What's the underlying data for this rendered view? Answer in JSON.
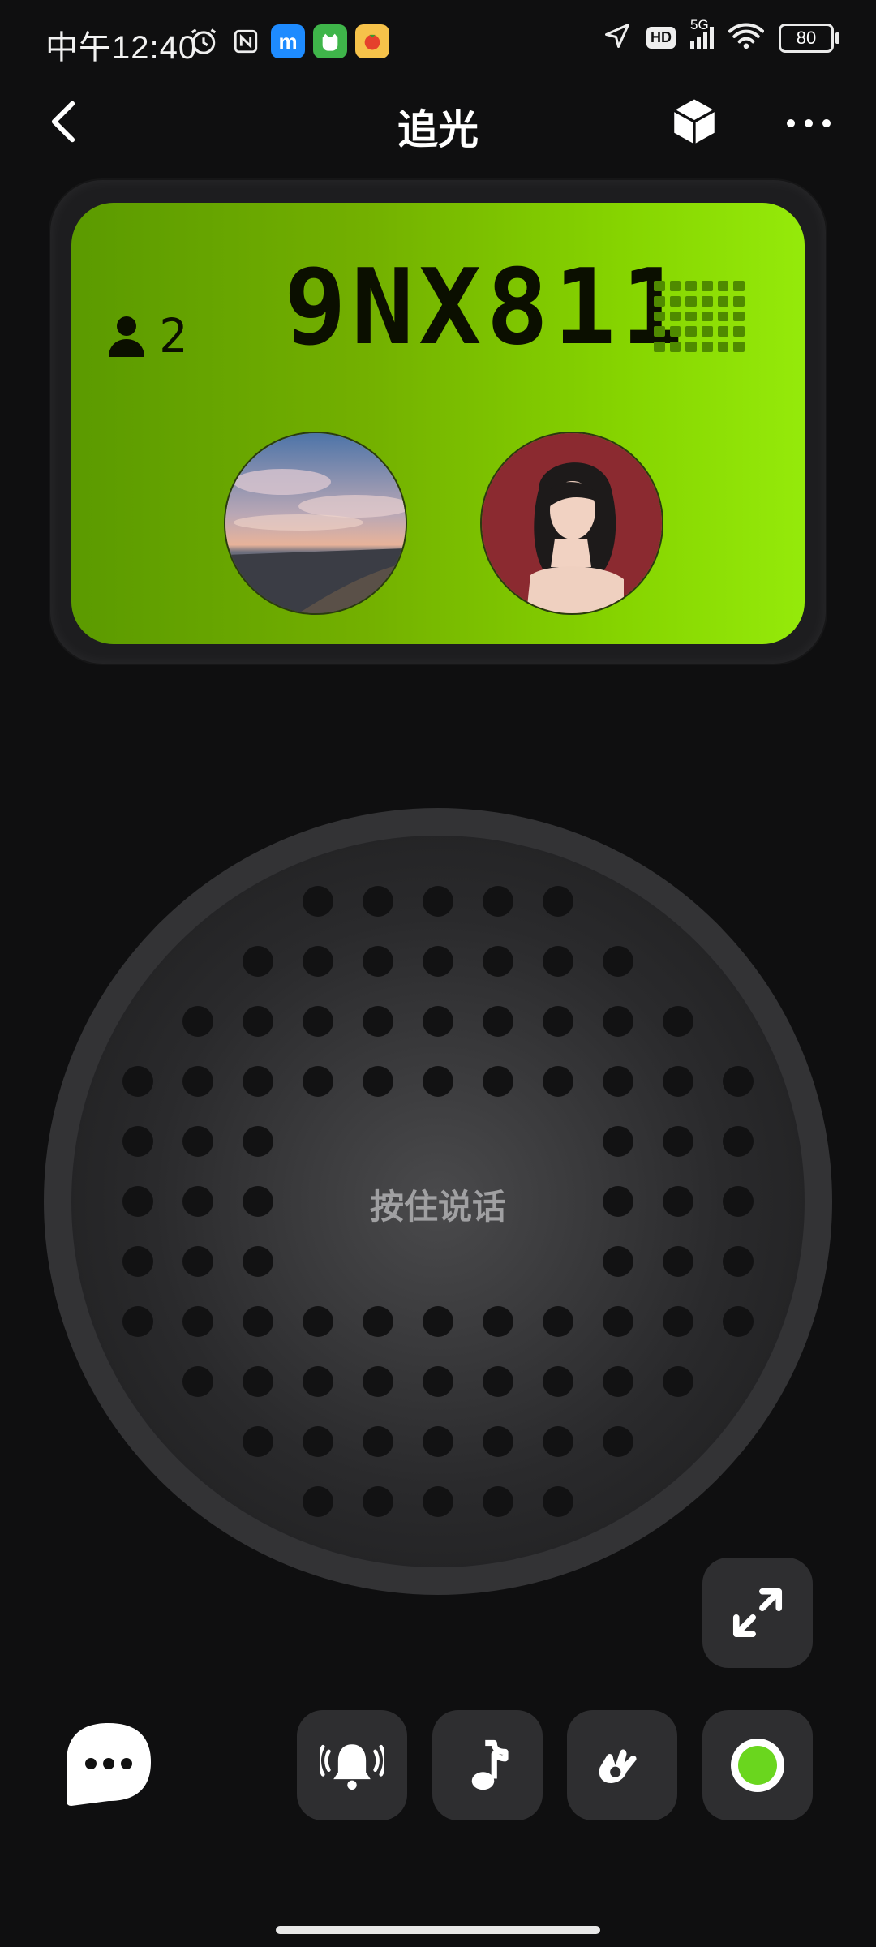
{
  "status_bar": {
    "time": "中午12:40",
    "network": "5G",
    "hd": "HD",
    "battery": "80",
    "app_icons": [
      "alarm-icon",
      "nfc-icon",
      "m-app-icon",
      "cat-app-icon",
      "tomato-app-icon"
    ]
  },
  "header": {
    "title": "追光"
  },
  "device": {
    "user_count": "2",
    "code": "9NX811"
  },
  "speaker": {
    "talk_label": "按住说话"
  },
  "colors": {
    "lcd_green": "#86d400",
    "record_green": "#6ad61e",
    "background": "#0f0f10"
  }
}
